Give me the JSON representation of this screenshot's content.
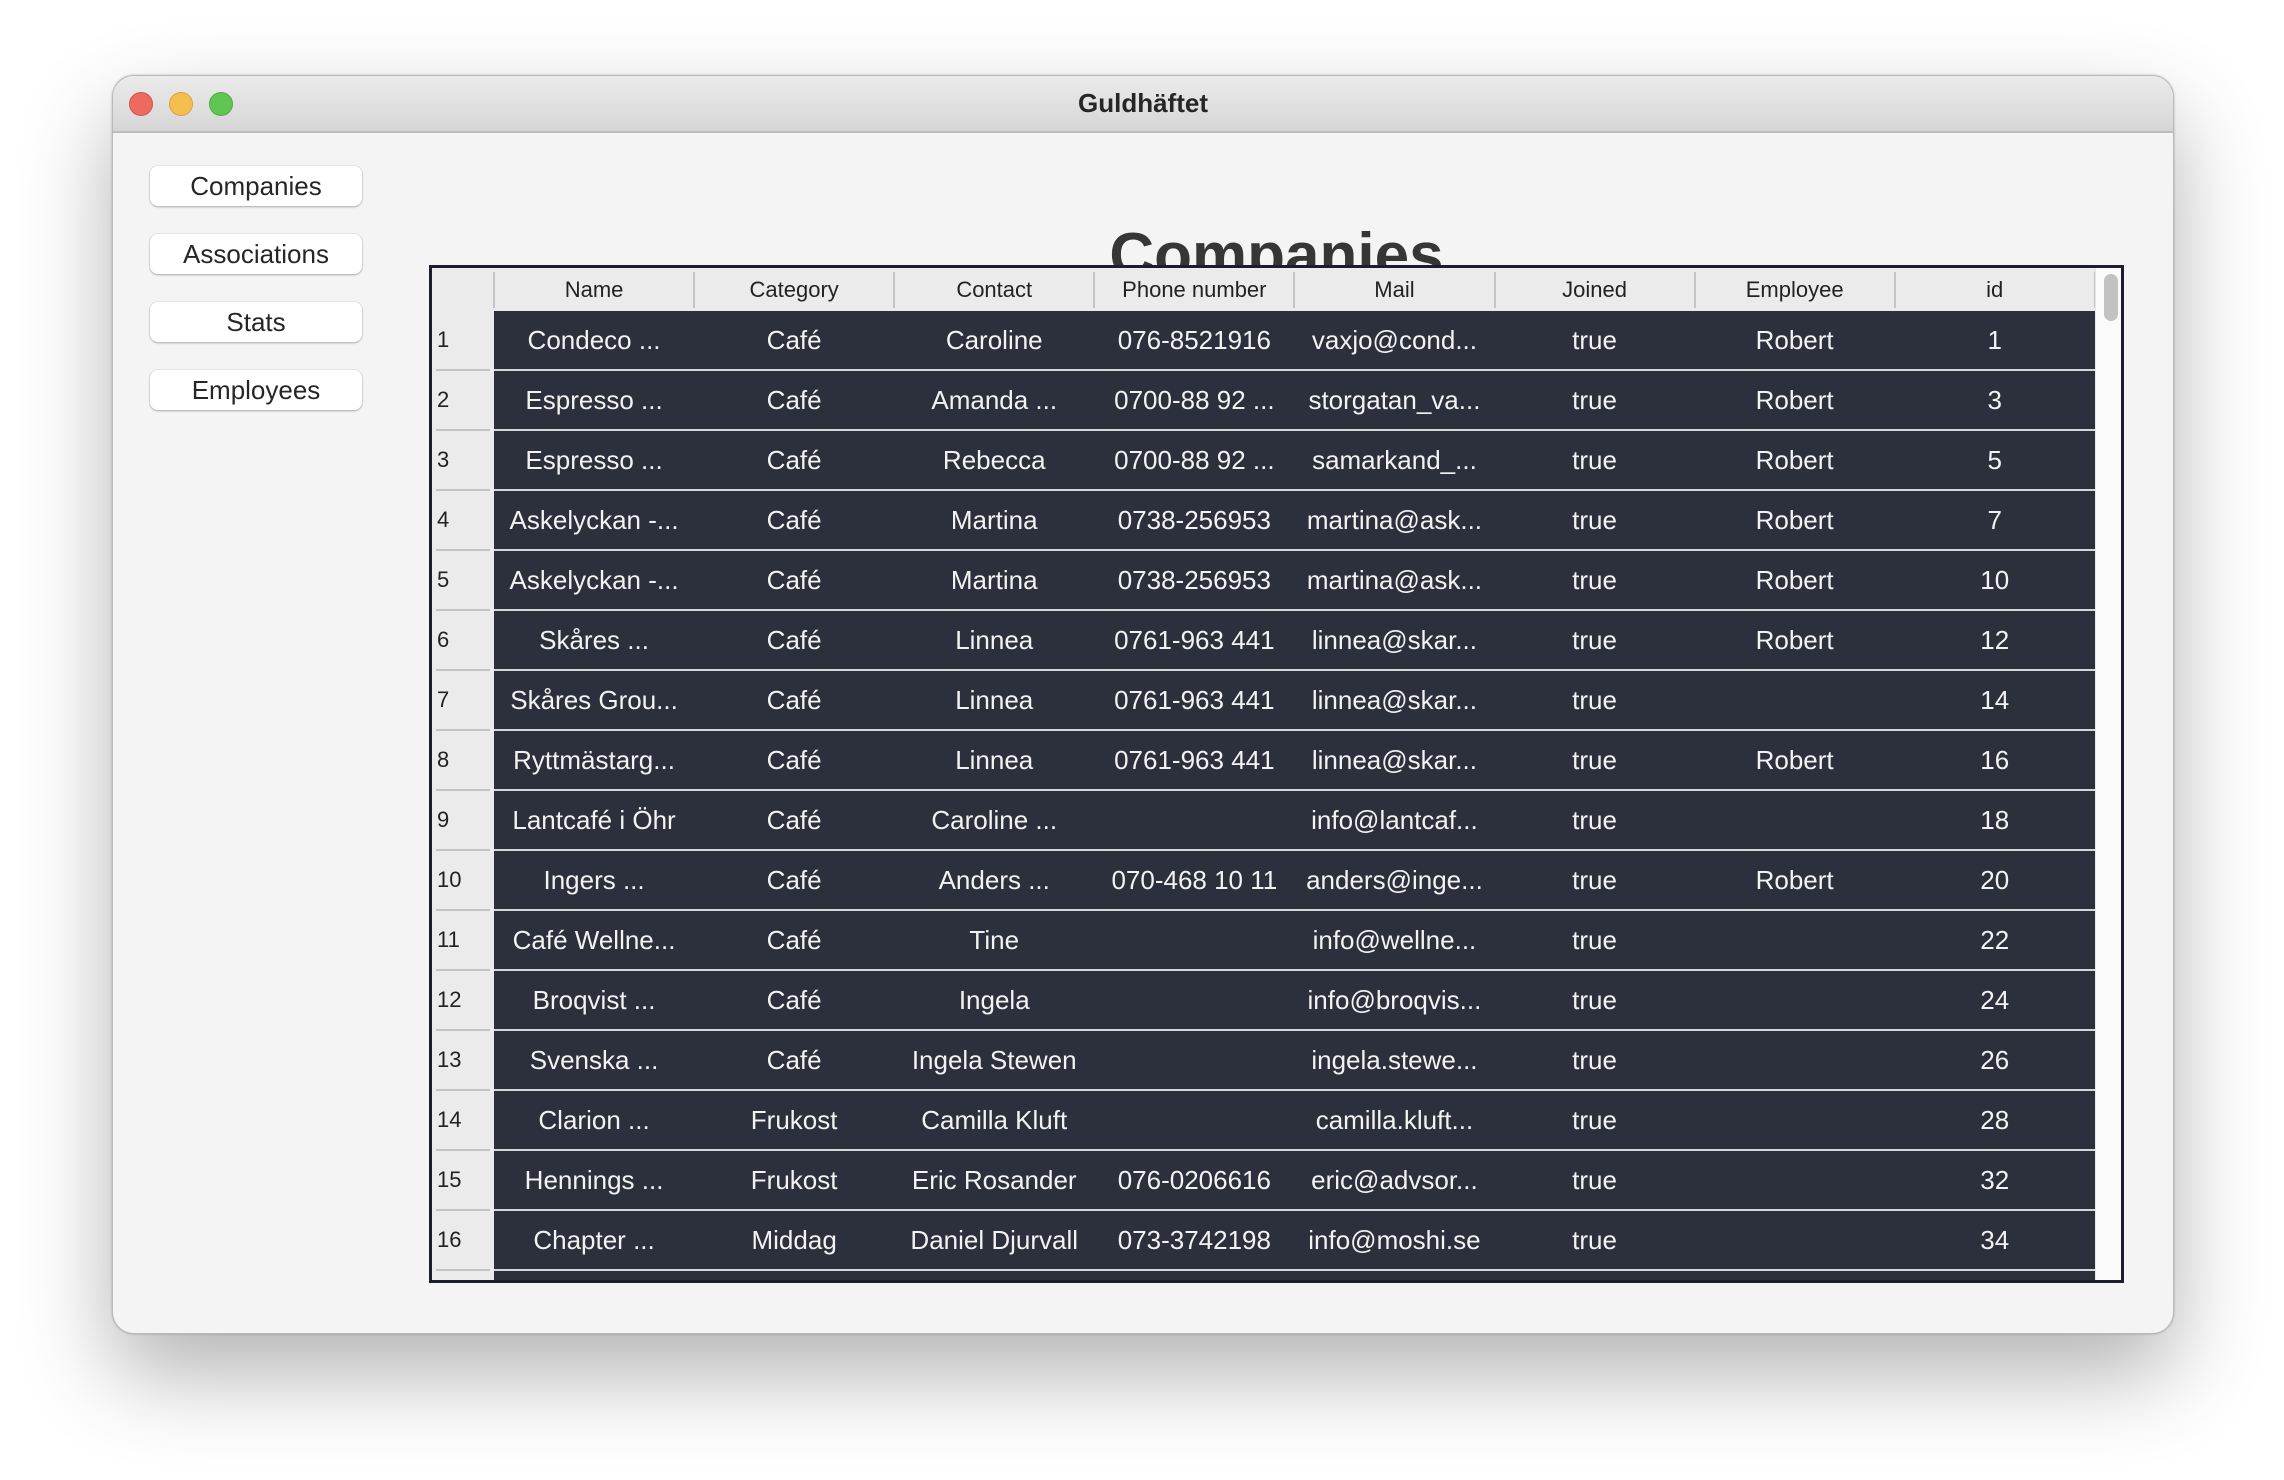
{
  "window": {
    "title": "Guldhäftet",
    "controls": [
      "close",
      "minimize",
      "maximize"
    ]
  },
  "sidebar": {
    "items": [
      {
        "label": "Companies"
      },
      {
        "label": "Associations"
      },
      {
        "label": "Stats"
      },
      {
        "label": "Employees"
      }
    ]
  },
  "main": {
    "heading": "Companies",
    "table": {
      "columns": [
        "Name",
        "Category",
        "Contact",
        "Phone number",
        "Mail",
        "Joined",
        "Employee",
        "id"
      ],
      "rows": [
        {
          "n": "1",
          "cells": [
            "Condeco ...",
            "Café",
            "Caroline",
            "076-8521916",
            "vaxjo@cond...",
            "true",
            "Robert",
            "1"
          ]
        },
        {
          "n": "2",
          "cells": [
            "Espresso ...",
            "Café",
            "Amanda ...",
            "0700-88 92 ...",
            "storgatan_va...",
            "true",
            "Robert",
            "3"
          ]
        },
        {
          "n": "3",
          "cells": [
            "Espresso ...",
            "Café",
            "Rebecca",
            "0700-88 92 ...",
            "samarkand_...",
            "true",
            "Robert",
            "5"
          ]
        },
        {
          "n": "4",
          "cells": [
            "Askelyckan -...",
            "Café",
            "Martina",
            "0738-256953",
            "martina@ask...",
            "true",
            "Robert",
            "7"
          ]
        },
        {
          "n": "5",
          "cells": [
            "Askelyckan -...",
            "Café",
            "Martina",
            "0738-256953",
            "martina@ask...",
            "true",
            "Robert",
            "10"
          ]
        },
        {
          "n": "6",
          "cells": [
            "Skåres ...",
            "Café",
            "Linnea",
            "0761-963 441",
            "linnea@skar...",
            "true",
            "Robert",
            "12"
          ]
        },
        {
          "n": "7",
          "cells": [
            "Skåres Grou...",
            "Café",
            "Linnea",
            "0761-963 441",
            "linnea@skar...",
            "true",
            "",
            "14"
          ]
        },
        {
          "n": "8",
          "cells": [
            "Ryttmästarg...",
            "Café",
            "Linnea",
            "0761-963 441",
            "linnea@skar...",
            "true",
            "Robert",
            "16"
          ]
        },
        {
          "n": "9",
          "cells": [
            "Lantcafé i Öhr",
            "Café",
            "Caroline ...",
            "",
            "info@lantcaf...",
            "true",
            "",
            "18"
          ]
        },
        {
          "n": "10",
          "cells": [
            "Ingers ...",
            "Café",
            "Anders ...",
            "070-468 10 11",
            "anders@inge...",
            "true",
            "Robert",
            "20"
          ]
        },
        {
          "n": "11",
          "cells": [
            "Café Wellne...",
            "Café",
            "Tine",
            "",
            "info@wellne...",
            "true",
            "",
            "22"
          ]
        },
        {
          "n": "12",
          "cells": [
            "Broqvist ...",
            "Café",
            "Ingela",
            "",
            "info@broqvis...",
            "true",
            "",
            "24"
          ]
        },
        {
          "n": "13",
          "cells": [
            "Svenska ...",
            "Café",
            "Ingela Stewen",
            "",
            "ingela.stewe...",
            "true",
            "",
            "26"
          ]
        },
        {
          "n": "14",
          "cells": [
            "Clarion ...",
            "Frukost",
            "Camilla Kluft",
            "",
            "camilla.kluft...",
            "true",
            "",
            "28"
          ]
        },
        {
          "n": "15",
          "cells": [
            "Hennings ...",
            "Frukost",
            "Eric Rosander",
            "076-0206616",
            "eric@advsor...",
            "true",
            "",
            "32"
          ]
        },
        {
          "n": "16",
          "cells": [
            "Chapter ...",
            "Middag",
            "Daniel Djurvall",
            "073-3742198",
            "info@moshi.se",
            "true",
            "",
            "34"
          ]
        },
        {
          "n": "",
          "cells": [
            "",
            "",
            "",
            "",
            "",
            "",
            "",
            ""
          ]
        }
      ]
    }
  },
  "colors": {
    "row_background": "#2c2f3c",
    "row_text": "#f2f2f2",
    "header_background": "#ebebeb",
    "window_background": "#f4f4f4"
  }
}
